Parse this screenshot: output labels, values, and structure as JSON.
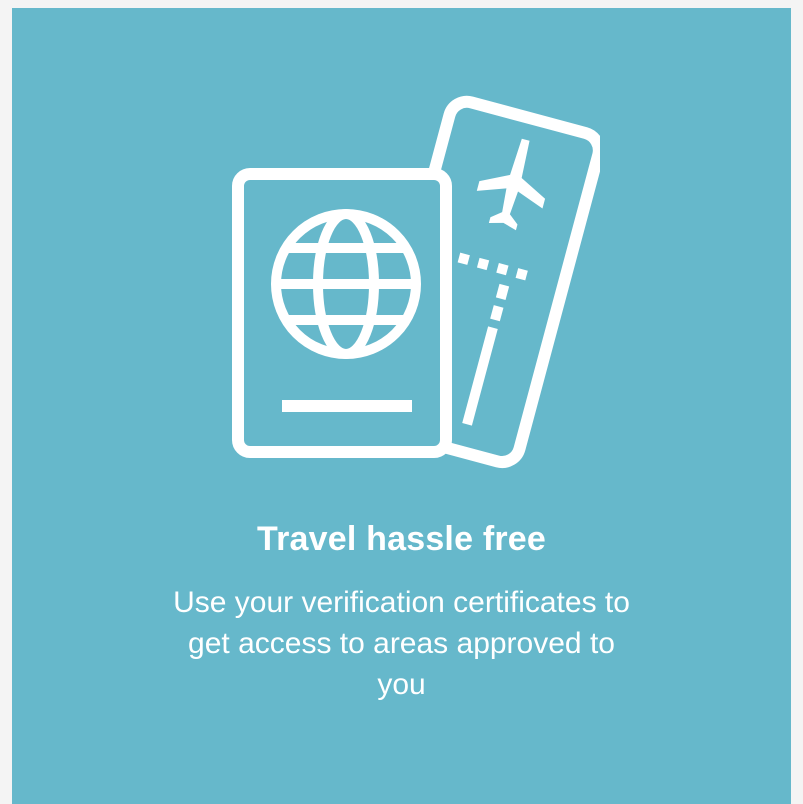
{
  "onboarding": {
    "title": "Travel hassle free",
    "description": "Use your verification certificates to get access to areas approved to you",
    "illustration_icon": "passport-and-boarding-pass-icon"
  },
  "colors": {
    "card_background": "#66b8cb",
    "foreground": "#ffffff",
    "page_background": "#f4f4f4"
  }
}
